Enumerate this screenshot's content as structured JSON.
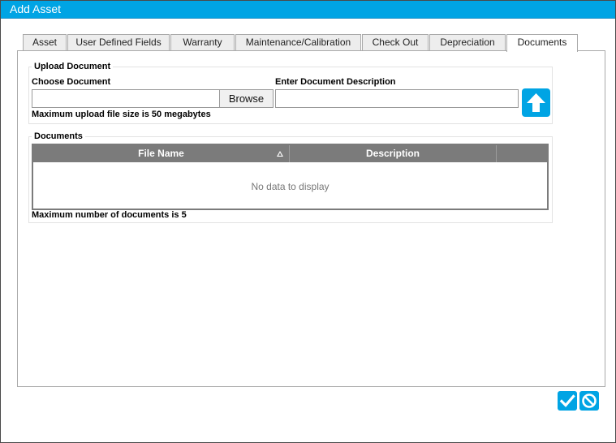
{
  "window": {
    "title": "Add Asset"
  },
  "tabs": [
    {
      "label": "Asset"
    },
    {
      "label": "User Defined Fields"
    },
    {
      "label": "Warranty"
    },
    {
      "label": "Maintenance/Calibration"
    },
    {
      "label": "Check Out"
    },
    {
      "label": "Depreciation"
    },
    {
      "label": "Documents",
      "active": true
    }
  ],
  "upload": {
    "legend": "Upload Document",
    "choose_label": "Choose Document",
    "file_value": "",
    "browse_label": "Browse",
    "description_label": "Enter Document Description",
    "description_value": "",
    "size_note": "Maximum upload file size is 50 megabytes",
    "upload_icon": "upload-arrow-icon"
  },
  "documents": {
    "legend": "Documents",
    "columns": [
      "File Name",
      "Description"
    ],
    "sort": {
      "column": "File Name",
      "direction": "ascending"
    },
    "empty_text": "No data to display",
    "count_note": "Maximum number of documents is 5"
  },
  "actions": {
    "confirm_icon": "checkmark-icon",
    "cancel_icon": "cancel-icon"
  },
  "colors": {
    "accent": "#00a4e4",
    "grid_header": "#7b7b7b"
  }
}
